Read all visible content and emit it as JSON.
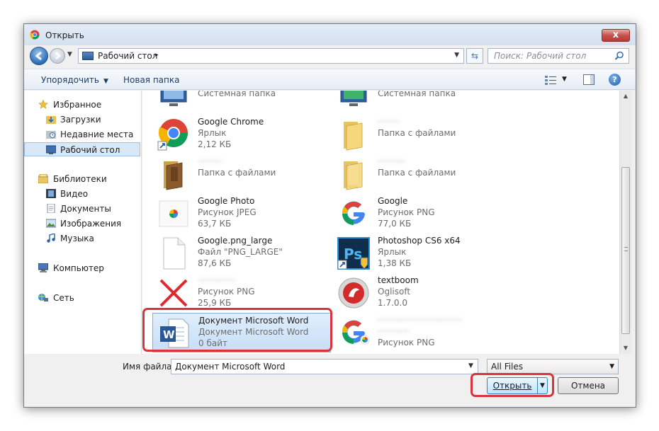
{
  "window": {
    "title": "Открыть",
    "close_label": "x"
  },
  "nav": {
    "address": "Рабочий стол",
    "address_sep": "▸",
    "search_placeholder": "Поиск: Рабочий стол"
  },
  "toolbar": {
    "organize_label": "Упорядочить",
    "new_folder_label": "Новая папка"
  },
  "sidebar": {
    "favorites": "Избранное",
    "downloads": "Загрузки",
    "recent": "Недавние места",
    "desktop": "Рабочий стол",
    "libraries": "Библиотеки",
    "video": "Видео",
    "documents": "Документы",
    "images": "Изображения",
    "music": "Музыка",
    "computer": "Компьютер",
    "network": "Сеть"
  },
  "files": [
    {
      "name": "",
      "type": "Системная папка",
      "size": ""
    },
    {
      "name": "",
      "type": "Системная папка",
      "size": ""
    },
    {
      "name": "Google Chrome",
      "type": "Ярлык",
      "size": "2,12 КБ"
    },
    {
      "name": "········",
      "type": "Папка с файлами",
      "size": ""
    },
    {
      "name": "·········",
      "type": "Папка с файлами",
      "size": ""
    },
    {
      "name": "··········",
      "type": "Папка с файлами",
      "size": ""
    },
    {
      "name": "Google Photo",
      "type": "Рисунок JPEG",
      "size": "63,7 КБ"
    },
    {
      "name": "Google",
      "type": "Рисунок PNG",
      "size": "77,0 КБ"
    },
    {
      "name": "Google.png_large",
      "type": "Файл \"PNG_LARGE\"",
      "size": "87,6 КБ"
    },
    {
      "name": "Photoshop CS6 x64",
      "type": "Ярлык",
      "size": "1,38 КБ"
    },
    {
      "name": "··············",
      "type": "Рисунок PNG",
      "size": "25,9 КБ"
    },
    {
      "name": "textboom",
      "type": "Oglisoft",
      "size": "1.7.0.0"
    },
    {
      "name": "Документ Microsoft Word",
      "type": "Документ Microsoft Word",
      "size": "0 байт"
    },
    {
      "name": "·······························",
      "type": "············",
      "size": "Рисунок PNG"
    }
  ],
  "bottom": {
    "filename_label": "Имя файла:",
    "filename_value": "Документ Microsoft Word",
    "filter_value": "All Files",
    "open_label": "Открыть",
    "cancel_label": "Отмена"
  },
  "colors": {
    "highlight": "#d9343d",
    "selection": "#c7def7",
    "accent": "#1e3f69"
  }
}
